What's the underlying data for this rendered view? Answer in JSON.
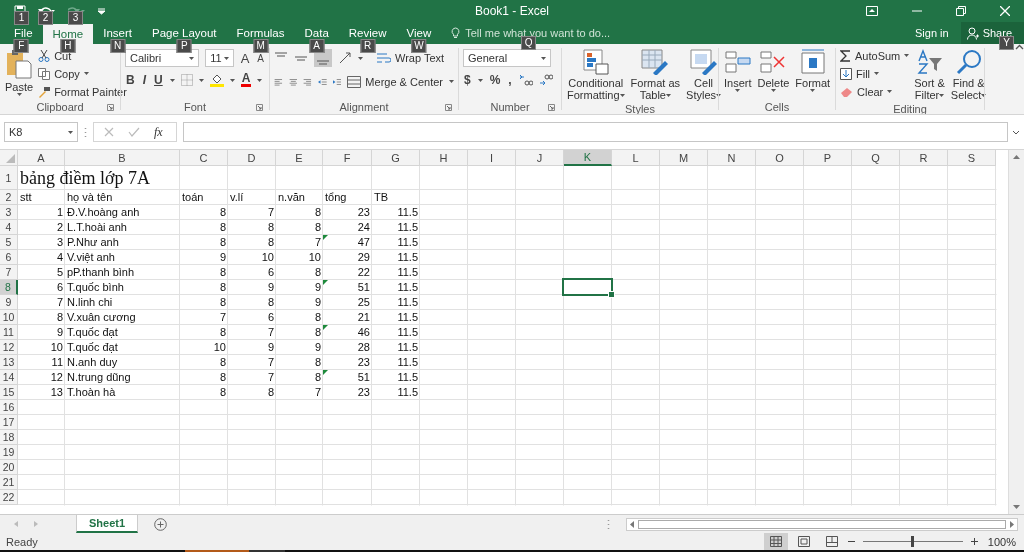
{
  "title_bar": {
    "title": "Book1 - Excel",
    "qat_keytips": [
      "1",
      "2",
      "3"
    ]
  },
  "tabs": [
    {
      "label": "File",
      "keytip": "F",
      "selected": false
    },
    {
      "label": "Home",
      "keytip": "H",
      "selected": true
    },
    {
      "label": "Insert",
      "keytip": "N",
      "selected": false
    },
    {
      "label": "Page Layout",
      "keytip": "P",
      "selected": false
    },
    {
      "label": "Formulas",
      "keytip": "M",
      "selected": false
    },
    {
      "label": "Data",
      "keytip": "A",
      "selected": false
    },
    {
      "label": "Review",
      "keytip": "R",
      "selected": false
    },
    {
      "label": "View",
      "keytip": "W",
      "selected": false
    }
  ],
  "tell_me": {
    "placeholder": "Tell me what you want to do...",
    "keytip": "Q"
  },
  "account": {
    "sign_in": "Sign in",
    "share": "Share",
    "share_keytip": "Y"
  },
  "ribbon": {
    "clipboard": {
      "label": "Clipboard",
      "paste": "Paste",
      "cut": "Cut",
      "copy": "Copy",
      "format_painter": "Format Painter"
    },
    "font": {
      "label": "Font",
      "font_name": "Calibri",
      "font_size": "11",
      "grow": "A",
      "shrink": "A",
      "bold": "B",
      "italic": "I",
      "underline": "U",
      "font_color": "A"
    },
    "alignment": {
      "label": "Alignment",
      "wrap_text": "Wrap Text",
      "merge_center": "Merge & Center"
    },
    "number": {
      "label": "Number",
      "format": "General",
      "currency": "$",
      "percent": "%",
      "comma": ","
    },
    "styles": {
      "label": "Styles",
      "buttons": [
        {
          "lines": [
            "Conditional",
            "Formatting"
          ],
          "kind": "conditional"
        },
        {
          "lines": [
            "Format as",
            "Table"
          ],
          "kind": "table"
        },
        {
          "lines": [
            "Cell",
            "Styles"
          ],
          "kind": "cellstyles"
        }
      ]
    },
    "cells": {
      "label": "Cells",
      "buttons": [
        {
          "label": "Insert",
          "kind": "insert"
        },
        {
          "label": "Delete",
          "kind": "delete"
        },
        {
          "label": "Format",
          "kind": "format"
        }
      ]
    },
    "editing": {
      "label": "Editing",
      "autosum": "AutoSum",
      "fill": "Fill",
      "clear": "Clear",
      "sort_filter": [
        "Sort &",
        "Filter"
      ],
      "find_select": [
        "Find &",
        "Select"
      ]
    }
  },
  "formula_bar": {
    "name_box": "K8",
    "fx": "fx"
  },
  "sheet": {
    "columns": [
      {
        "label": "A",
        "selected": false
      },
      {
        "label": "B",
        "selected": false
      },
      {
        "label": "C",
        "selected": false
      },
      {
        "label": "D",
        "selected": false
      },
      {
        "label": "E",
        "selected": false
      },
      {
        "label": "F",
        "selected": false
      },
      {
        "label": "G",
        "selected": false
      },
      {
        "label": "H",
        "selected": false
      },
      {
        "label": "I",
        "selected": false
      },
      {
        "label": "J",
        "selected": false
      },
      {
        "label": "K",
        "selected": true
      },
      {
        "label": "L",
        "selected": false
      },
      {
        "label": "M",
        "selected": false
      },
      {
        "label": "N",
        "selected": false
      },
      {
        "label": "O",
        "selected": false
      },
      {
        "label": "P",
        "selected": false
      },
      {
        "label": "Q",
        "selected": false
      },
      {
        "label": "R",
        "selected": false
      },
      {
        "label": "S",
        "selected": false
      }
    ],
    "rows": [
      {
        "label": "1",
        "selected": false,
        "kind": "title",
        "cells": [
          "bảng điềm lớp 7A"
        ]
      },
      {
        "label": "2",
        "selected": false,
        "kind": "header",
        "cells": [
          "stt",
          "họ và tên",
          "toán",
          "v.lí",
          "n.văn",
          "tổng",
          "TB"
        ]
      },
      {
        "label": "3",
        "selected": false,
        "kind": "data",
        "flagged": false,
        "cells": [
          "1",
          "Đ.V.hoàng anh",
          "8",
          "7",
          "8",
          "23",
          "11.5"
        ]
      },
      {
        "label": "4",
        "selected": false,
        "kind": "data",
        "flagged": false,
        "cells": [
          "2",
          "L.T.hoài anh",
          "8",
          "8",
          "8",
          "24",
          "11.5"
        ]
      },
      {
        "label": "5",
        "selected": false,
        "kind": "data",
        "flagged": true,
        "cells": [
          "3",
          "P.Như anh",
          "8",
          "8",
          "7",
          "47",
          "11.5"
        ]
      },
      {
        "label": "6",
        "selected": false,
        "kind": "data",
        "flagged": false,
        "cells": [
          "4",
          "V.việt anh",
          "9",
          "10",
          "10",
          "29",
          "11.5"
        ]
      },
      {
        "label": "7",
        "selected": false,
        "kind": "data",
        "flagged": false,
        "cells": [
          "5",
          "pP.thanh bình",
          "8",
          "6",
          "8",
          "22",
          "11.5"
        ]
      },
      {
        "label": "8",
        "selected": true,
        "kind": "data",
        "flagged": true,
        "cells": [
          "6",
          "T.quốc bình",
          "8",
          "9",
          "9",
          "51",
          "11.5"
        ]
      },
      {
        "label": "9",
        "selected": false,
        "kind": "data",
        "flagged": false,
        "cells": [
          "7",
          "N.linh chi",
          "8",
          "8",
          "9",
          "25",
          "11.5"
        ]
      },
      {
        "label": "10",
        "selected": false,
        "kind": "data",
        "flagged": false,
        "cells": [
          "8",
          "V.xuân cương",
          "7",
          "6",
          "8",
          "21",
          "11.5"
        ]
      },
      {
        "label": "11",
        "selected": false,
        "kind": "data",
        "flagged": true,
        "cells": [
          "9",
          "T.quốc đạt",
          "8",
          "7",
          "8",
          "46",
          "11.5"
        ]
      },
      {
        "label": "12",
        "selected": false,
        "kind": "data",
        "flagged": false,
        "cells": [
          "10",
          "T.quốc đạt",
          "10",
          "9",
          "9",
          "28",
          "11.5"
        ]
      },
      {
        "label": "13",
        "selected": false,
        "kind": "data",
        "flagged": false,
        "cells": [
          "11",
          "N.anh duy",
          "8",
          "7",
          "8",
          "23",
          "11.5"
        ]
      },
      {
        "label": "14",
        "selected": false,
        "kind": "data",
        "flagged": true,
        "cells": [
          "12",
          "N.trung dũng",
          "8",
          "7",
          "8",
          "51",
          "11.5"
        ]
      },
      {
        "label": "15",
        "selected": false,
        "kind": "data",
        "flagged": false,
        "cells": [
          "13",
          "T.hoàn hà",
          "8",
          "8",
          "7",
          "23",
          "11.5"
        ]
      },
      {
        "label": "16",
        "selected": false,
        "kind": "empty"
      },
      {
        "label": "17",
        "selected": false,
        "kind": "empty"
      },
      {
        "label": "18",
        "selected": false,
        "kind": "empty"
      },
      {
        "label": "19",
        "selected": false,
        "kind": "empty"
      },
      {
        "label": "20",
        "selected": false,
        "kind": "empty"
      },
      {
        "label": "21",
        "selected": false,
        "kind": "empty"
      },
      {
        "label": "22",
        "selected": false,
        "kind": "empty"
      }
    ]
  },
  "sheet_tabs": [
    {
      "label": "Sheet1",
      "selected": true
    }
  ],
  "status_bar": {
    "status": "Ready",
    "views": [
      {
        "kind": "normal",
        "selected": true
      },
      {
        "kind": "page_layout",
        "selected": false
      },
      {
        "kind": "page_break",
        "selected": false
      }
    ],
    "zoom": {
      "level": 0.5,
      "reading": "100%"
    }
  }
}
